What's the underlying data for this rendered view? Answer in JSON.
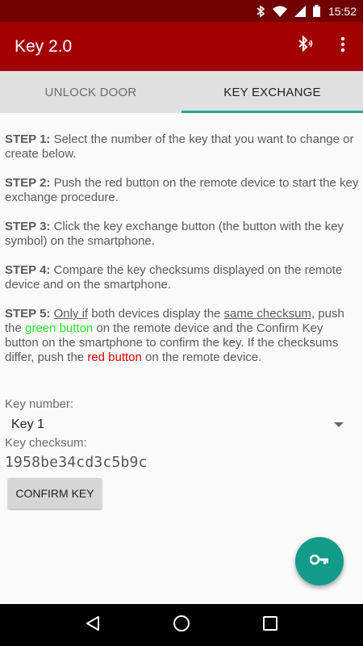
{
  "status_bar": {
    "time": "15:52",
    "icons": [
      "bluetooth-icon",
      "wifi-icon",
      "signal-icon",
      "battery-icon"
    ]
  },
  "app_bar": {
    "title": "Key 2.0",
    "actions": [
      "bluetooth-audio-icon",
      "more-vert-icon"
    ]
  },
  "tabs": [
    {
      "label": "UNLOCK DOOR",
      "active": false
    },
    {
      "label": "KEY EXCHANGE",
      "active": true
    }
  ],
  "steps": [
    {
      "title": "STEP 1:",
      "text": " Select the number of the key that you want to change or create below."
    },
    {
      "title": "STEP 2:",
      "text": " Push the red button on the remote device to start the key exchange procedure."
    },
    {
      "title": "STEP 3:",
      "text": " Click the key exchange button (the button with the key symbol) on the smartphone."
    },
    {
      "title": "STEP 4:",
      "text": " Compare the key checksums displayed on the remote device and on the smartphone."
    },
    {
      "title": "STEP 5:",
      "parts": {
        "only_if": "Only if",
        "t1": " both devices display the ",
        "same_checksum": "same checksum",
        "t2": ", push the ",
        "green_button": "green button",
        "t3": " on the remote device and the Confirm Key button on the smartphone to confirm the key. If the checksums differ, push the ",
        "red_button": "red button",
        "t4": " on the remote device."
      }
    }
  ],
  "key_number": {
    "label": "Key number:",
    "selected": "Key 1"
  },
  "key_checksum": {
    "label": "Key checksum:",
    "value": "1958be34cd3c5b9c"
  },
  "confirm_button": {
    "label": "CONFIRM KEY"
  },
  "fab": {
    "icon": "vpn-key-icon"
  },
  "nav_bar": {
    "icons": [
      "back-icon",
      "home-icon",
      "recents-icon"
    ]
  },
  "colors": {
    "app_bar": "#a30000",
    "status_bar": "#710000",
    "accent": "#26a69a",
    "fab": "#139b8a",
    "green_text": "#2ee32e",
    "red_text": "#e00000"
  }
}
